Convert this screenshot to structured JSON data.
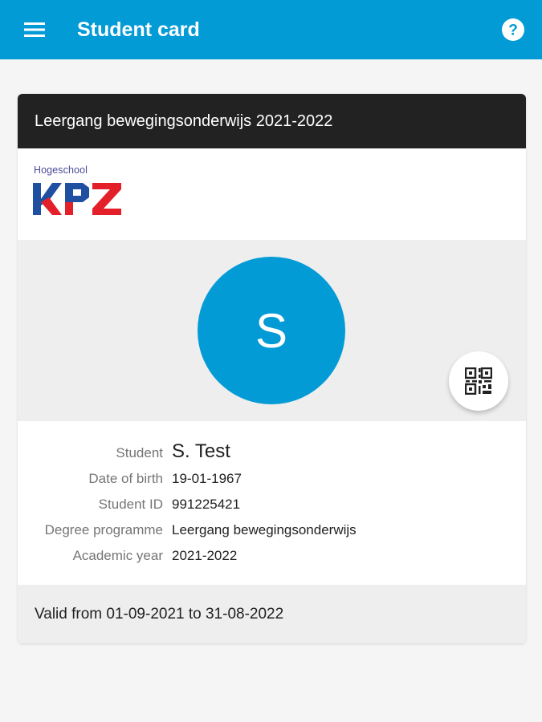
{
  "app_bar": {
    "title": "Student card",
    "background_color": "#039bd6",
    "menu_icon": "menu-icon",
    "help_icon": "help-icon"
  },
  "card": {
    "header_title": "Leergang bewegingsonderwijs 2021-2022",
    "logo": {
      "subtitle": "Hogeschool",
      "letters": "KPZ"
    },
    "avatar_initial": "S",
    "qr_icon": "qr-code-icon",
    "details": [
      {
        "label": "Student",
        "value": "S. Test"
      },
      {
        "label": "Date of birth",
        "value": "19-01-1967"
      },
      {
        "label": "Student ID",
        "value": "991225421"
      },
      {
        "label": "Degree programme",
        "value": "Leergang bewegingsonderwijs"
      },
      {
        "label": "Academic year",
        "value": "2021-2022"
      }
    ],
    "validity": "Valid from 01-09-2021 to 31-08-2022"
  }
}
